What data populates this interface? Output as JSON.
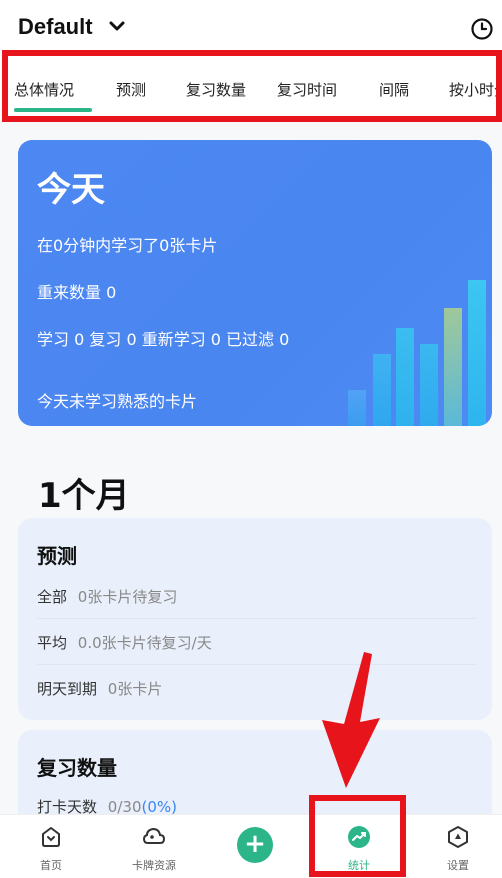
{
  "header": {
    "title": "Default"
  },
  "tabs": [
    {
      "label": "总体情况"
    },
    {
      "label": "预测"
    },
    {
      "label": "复习数量"
    },
    {
      "label": "复习时间"
    },
    {
      "label": "间隔"
    },
    {
      "label": "按小时分"
    }
  ],
  "today": {
    "title": "今天",
    "studied": "在0分钟内学习了0张卡片",
    "relearn": "重来数量 0",
    "breakdown": "学习 0 复习 0 重新学习 0 已过滤 0",
    "mature": "今天未学习熟悉的卡片"
  },
  "month": {
    "title": "1个月"
  },
  "forecast": {
    "title": "预测",
    "rows": [
      {
        "label": "全部",
        "value": "0张卡片待复习"
      },
      {
        "label": "平均",
        "value": "0.0张卡片待复习/天"
      },
      {
        "label": "明天到期",
        "value": "0张卡片"
      }
    ]
  },
  "review": {
    "title": "复习数量",
    "checkin_label": "打卡天数",
    "checkin_value": "0/30",
    "checkin_pct": "(0%)"
  },
  "nav": {
    "home": "首页",
    "decks": "卡牌资源",
    "add": "+",
    "stats": "统计",
    "settings": "设置"
  },
  "colors": {
    "accent": "#2bb588",
    "card_blue": "#4a86f0",
    "highlight_red": "#e8141c"
  }
}
